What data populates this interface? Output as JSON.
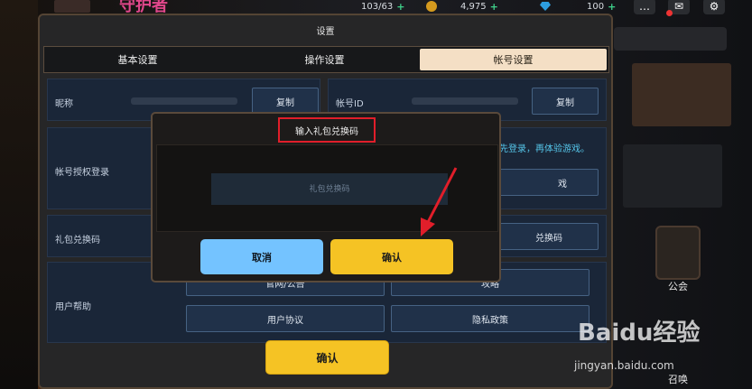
{
  "topbar": {
    "energy": "103/63",
    "gold": "4,975",
    "gems": "100",
    "plus": "+"
  },
  "background": {
    "title_fragment": "守护者",
    "guild_label": "公会",
    "summon_label": "召唤"
  },
  "dialog": {
    "title": "设置",
    "tabs": [
      {
        "label": "基本设置",
        "active": false
      },
      {
        "label": "操作设置",
        "active": false
      },
      {
        "label": "帐号设置",
        "active": true
      }
    ],
    "nickname_label": "昵称",
    "copy_label": "复制",
    "account_id_label": "帐号ID",
    "copy_label_2": "复制",
    "auth_label": "帐号授权登录",
    "auth_note": "先登录，再体验游戏。",
    "auth_button_fragment": "戏",
    "giftcode_label": "礼包兑换码",
    "giftcode_button_fragment": "兑换码",
    "help_label": "用户帮助",
    "official_notice": "官网/公告",
    "strategy": "攻略",
    "user_agreement": "用户协议",
    "privacy_policy": "隐私政策",
    "confirm": "确认"
  },
  "popup": {
    "title": "输入礼包兑换码",
    "input_placeholder": "礼包兑换码",
    "cancel": "取消",
    "confirm": "确认"
  },
  "colors": {
    "accent_yellow": "#f5c324",
    "cancel_blue": "#74c3ff",
    "highlight_red": "#e11e2a"
  },
  "watermark": {
    "logo": "Baidu经验",
    "url": "jingyan.baidu.com"
  }
}
